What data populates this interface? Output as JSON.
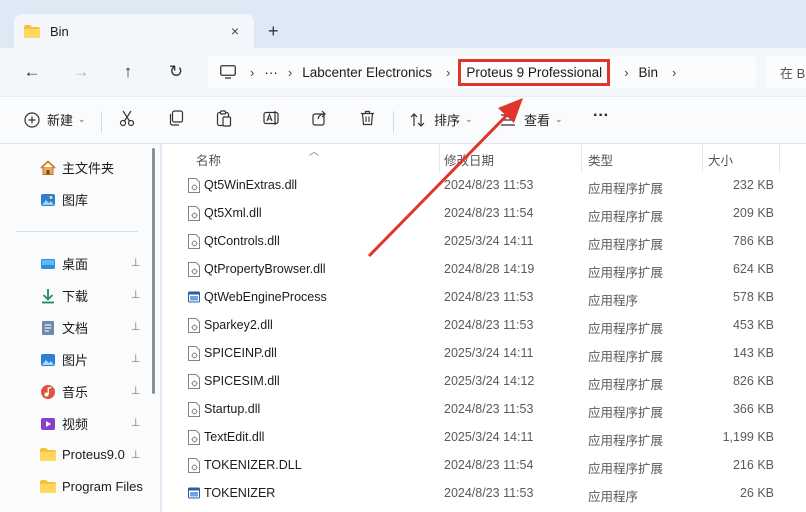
{
  "tab": {
    "title": "Bin",
    "close_glyph": "×",
    "new_tab_glyph": "+"
  },
  "nav": {
    "back": "←",
    "forward": "→",
    "up": "↑",
    "refresh": "↻"
  },
  "breadcrumb": {
    "ellipsis": "···",
    "items": [
      "Labcenter Electronics",
      "Proteus 9 Professional",
      "Bin"
    ],
    "highlighted_item": "Proteus 9 Professional",
    "highlight_color": "#e0352b"
  },
  "search": {
    "placeholder": "在 B"
  },
  "toolbar": {
    "new_label": "新建",
    "sort_label": "排序",
    "view_label": "查看",
    "more_glyph": "···"
  },
  "sidebar": {
    "quick": [
      {
        "label": "主文件夹",
        "icon": "home-icon"
      },
      {
        "label": "图库",
        "icon": "gallery-icon"
      }
    ],
    "pinned": [
      {
        "label": "桌面",
        "icon": "desktop-icon"
      },
      {
        "label": "下载",
        "icon": "download-icon"
      },
      {
        "label": "文档",
        "icon": "document-icon"
      },
      {
        "label": "图片",
        "icon": "pictures-icon"
      },
      {
        "label": "音乐",
        "icon": "music-icon"
      },
      {
        "label": "视频",
        "icon": "video-icon"
      },
      {
        "label": "Proteus9.0",
        "icon": "folder-icon"
      },
      {
        "label": "Program Files",
        "icon": "folder-icon"
      }
    ],
    "pin_glyph": "📌"
  },
  "columns": {
    "name": "名称",
    "date": "修改日期",
    "type": "类型",
    "size": "大小"
  },
  "files": [
    {
      "name": "Qt5WinExtras.dll",
      "date": "2024/8/23 11:53",
      "type": "应用程序扩展",
      "size": "232 KB",
      "icon": "dll-file-icon"
    },
    {
      "name": "Qt5Xml.dll",
      "date": "2024/8/23 11:54",
      "type": "应用程序扩展",
      "size": "209 KB",
      "icon": "dll-file-icon"
    },
    {
      "name": "QtControls.dll",
      "date": "2025/3/24 14:11",
      "type": "应用程序扩展",
      "size": "786 KB",
      "icon": "dll-file-icon"
    },
    {
      "name": "QtPropertyBrowser.dll",
      "date": "2024/8/28 14:19",
      "type": "应用程序扩展",
      "size": "624 KB",
      "icon": "dll-file-icon"
    },
    {
      "name": "QtWebEngineProcess",
      "date": "2024/8/23 11:53",
      "type": "应用程序",
      "size": "578 KB",
      "icon": "exe-file-icon"
    },
    {
      "name": "Sparkey2.dll",
      "date": "2024/8/23 11:53",
      "type": "应用程序扩展",
      "size": "453 KB",
      "icon": "dll-file-icon"
    },
    {
      "name": "SPICEINP.dll",
      "date": "2025/3/24 14:11",
      "type": "应用程序扩展",
      "size": "143 KB",
      "icon": "dll-file-icon"
    },
    {
      "name": "SPICESIM.dll",
      "date": "2025/3/24 14:12",
      "type": "应用程序扩展",
      "size": "826 KB",
      "icon": "dll-file-icon"
    },
    {
      "name": "Startup.dll",
      "date": "2024/8/23 11:53",
      "type": "应用程序扩展",
      "size": "366 KB",
      "icon": "dll-file-icon"
    },
    {
      "name": "TextEdit.dll",
      "date": "2025/3/24 14:11",
      "type": "应用程序扩展",
      "size": "1,199 KB",
      "icon": "dll-file-icon"
    },
    {
      "name": "TOKENIZER.DLL",
      "date": "2024/8/23 11:54",
      "type": "应用程序扩展",
      "size": "216 KB",
      "icon": "dll-file-icon"
    },
    {
      "name": "TOKENIZER",
      "date": "2024/8/23 11:53",
      "type": "应用程序",
      "size": "26 KB",
      "icon": "exe-file-icon"
    }
  ],
  "annotation": {
    "arrow_color": "#e0352b"
  }
}
